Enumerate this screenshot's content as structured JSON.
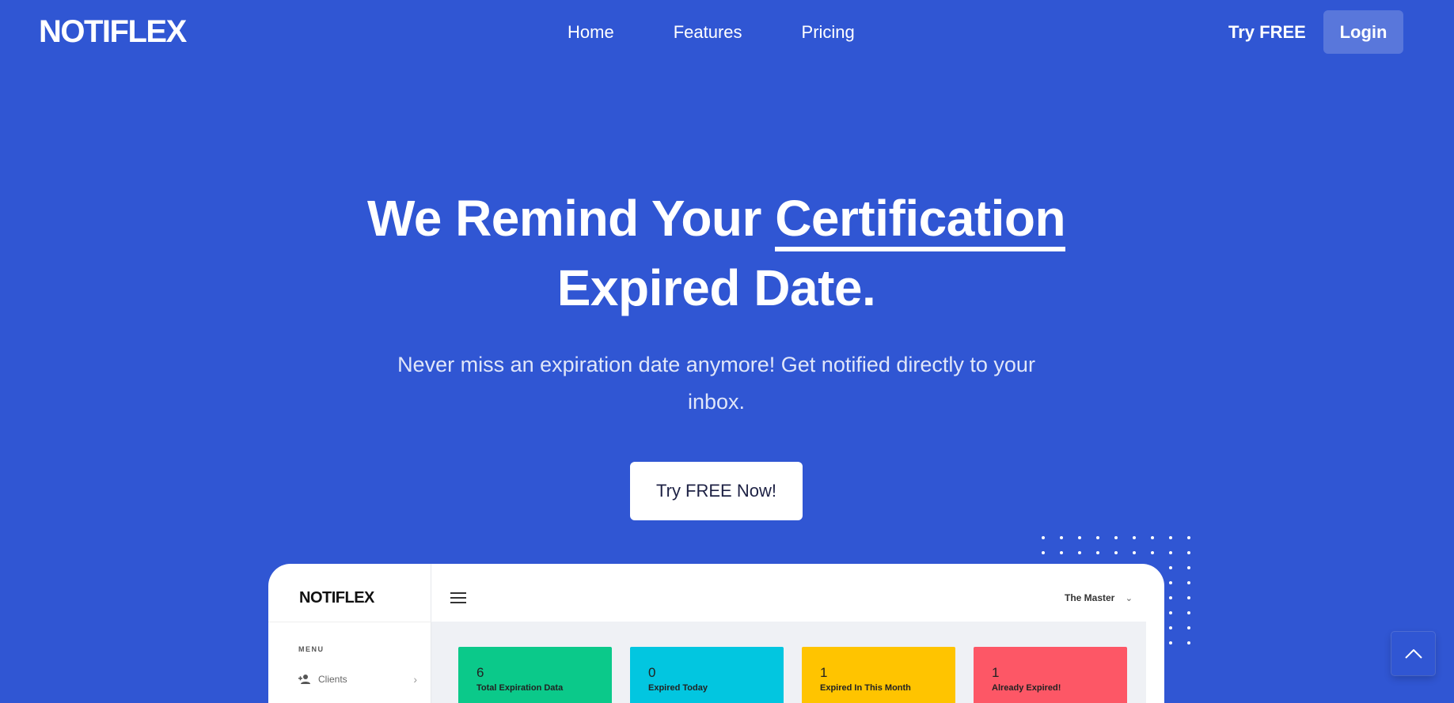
{
  "nav": {
    "logo": "NOTIFLEX",
    "links": [
      {
        "label": "Home"
      },
      {
        "label": "Features"
      },
      {
        "label": "Pricing"
      }
    ],
    "try_free": "Try FREE",
    "login": "Login"
  },
  "hero": {
    "title_part1": "We Remind Your",
    "title_highlight": "Certification",
    "title_part2": "Expired Date.",
    "subtitle": "Never miss an expiration date anymore! Get notified directly to your inbox.",
    "cta": "Try FREE Now!"
  },
  "preview": {
    "logo": "NOTIFLEX",
    "menu_label": "MENU",
    "clients_label": "Clients",
    "user_name": "The Master",
    "stats": [
      {
        "value": "6",
        "label": "Total Expiration Data",
        "color": "#0bc98a"
      },
      {
        "value": "0",
        "label": "Expired Today",
        "color": "#02c6e0"
      },
      {
        "value": "1",
        "label": "Expired In This Month",
        "color": "#ffc400"
      },
      {
        "value": "1",
        "label": "Already Expired!",
        "color": "#fd5766"
      }
    ]
  },
  "colors": {
    "background": "#3056d3",
    "accent_white": "#ffffff"
  },
  "icons": {
    "hamburger": "menu-icon",
    "clients": "add-user-icon",
    "chevron_right": "chevron-right-icon",
    "chevron_down": "chevron-down-icon",
    "back_to_top": "chevron-up-icon"
  }
}
